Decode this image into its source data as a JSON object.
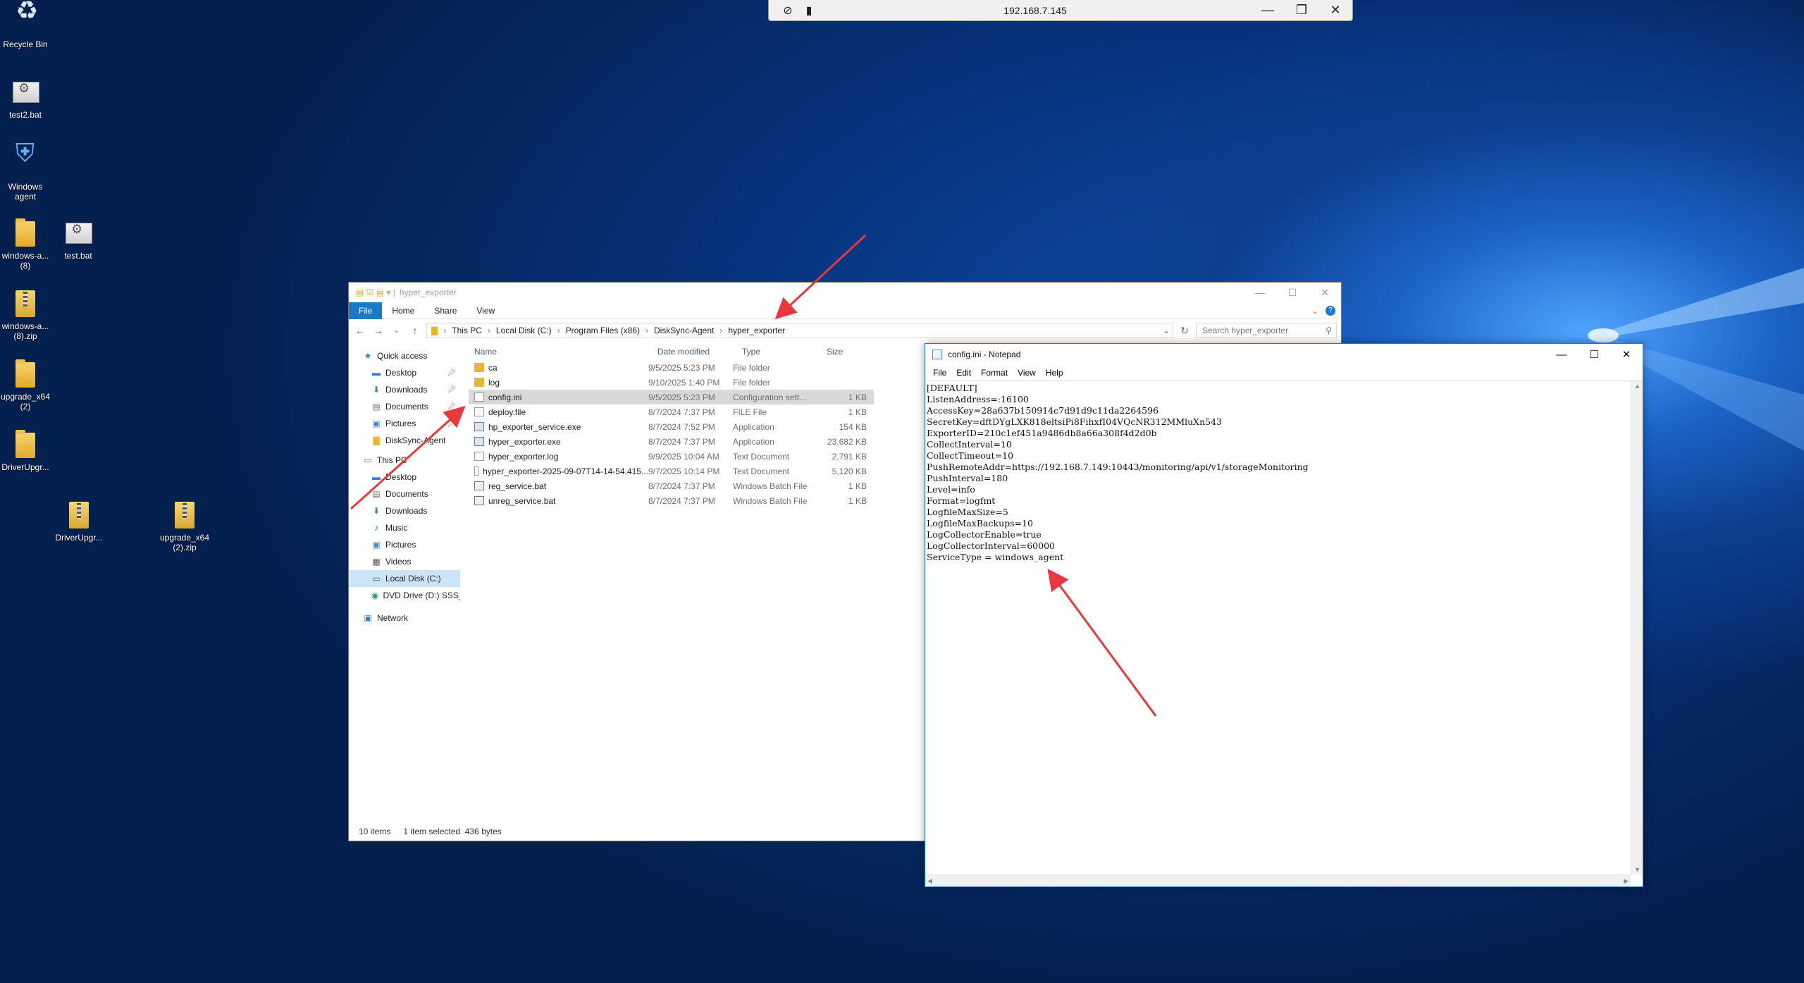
{
  "desktop": {
    "icons": [
      {
        "label": "Recycle Bin",
        "icon": "recycle-bin-icon"
      },
      {
        "label": "test2.bat",
        "icon": "batch-file-icon"
      },
      {
        "label": "Windows agent",
        "icon": "agent-shield-icon"
      },
      {
        "label": "windows-a... (8)",
        "icon": "folder-icon"
      },
      {
        "label": "test.bat",
        "icon": "batch-file-icon"
      },
      {
        "label": "windows-a... (8).zip",
        "icon": "zip-folder-icon"
      },
      {
        "label": "upgrade_x64 (2)",
        "icon": "folder-icon"
      },
      {
        "label": "DriverUpgr...",
        "icon": "folder-icon"
      },
      {
        "label": "DriverUpgr...",
        "icon": "zip-folder-icon"
      },
      {
        "label": "upgrade_x64 (2).zip",
        "icon": "zip-folder-icon"
      }
    ]
  },
  "rdp_bar": {
    "host": "192.168.7.145",
    "pin_icon": "pin-off-icon",
    "signal_icon": "signal-bars-icon"
  },
  "explorer": {
    "title": "hyper_exporter",
    "ribbon_tabs": [
      "File",
      "Home",
      "Share",
      "View"
    ],
    "breadcrumb": [
      "This PC",
      "Local Disk (C:)",
      "Program Files (x86)",
      "DiskSync-Agent",
      "hyper_exporter"
    ],
    "search_placeholder": "Search hyper_exporter",
    "nav": {
      "quick_access": "Quick access",
      "quick_items": [
        "Desktop",
        "Downloads",
        "Documents",
        "Pictures",
        "DiskSync-Agent"
      ],
      "this_pc": "This PC",
      "pc_items": [
        "Desktop",
        "Documents",
        "Downloads",
        "Music",
        "Pictures",
        "Videos",
        "Local Disk (C:)",
        "DVD Drive (D:) SSS_"
      ],
      "network": "Network"
    },
    "columns": {
      "name": "Name",
      "date": "Date modified",
      "type": "Type",
      "size": "Size"
    },
    "files": [
      {
        "name": "ca",
        "date": "9/5/2025 5:23 PM",
        "type": "File folder",
        "size": "",
        "kind": "folder"
      },
      {
        "name": "log",
        "date": "9/10/2025 1:40 PM",
        "type": "File folder",
        "size": "",
        "kind": "folder"
      },
      {
        "name": "config.ini",
        "date": "9/5/2025 5:23 PM",
        "type": "Configuration sett...",
        "size": "1 KB",
        "kind": "doc"
      },
      {
        "name": "deploy.file",
        "date": "8/7/2024 7:37 PM",
        "type": "FILE File",
        "size": "1 KB",
        "kind": "doc"
      },
      {
        "name": "hp_exporter_service.exe",
        "date": "8/7/2024 7:52 PM",
        "type": "Application",
        "size": "154 KB",
        "kind": "exe"
      },
      {
        "name": "hyper_exporter.exe",
        "date": "8/7/2024 7:37 PM",
        "type": "Application",
        "size": "23,682 KB",
        "kind": "exe"
      },
      {
        "name": "hyper_exporter.log",
        "date": "9/9/2025 10:04 AM",
        "type": "Text Document",
        "size": "2,791 KB",
        "kind": "doc"
      },
      {
        "name": "hyper_exporter-2025-09-07T14-14-54.415...",
        "date": "9/7/2025 10:14 PM",
        "type": "Text Document",
        "size": "5,120 KB",
        "kind": "doc"
      },
      {
        "name": "reg_service.bat",
        "date": "8/7/2024 7:37 PM",
        "type": "Windows Batch File",
        "size": "1 KB",
        "kind": "bat"
      },
      {
        "name": "unreg_service.bat",
        "date": "8/7/2024 7:37 PM",
        "type": "Windows Batch File",
        "size": "1 KB",
        "kind": "bat"
      }
    ],
    "selected_index": 2,
    "status": {
      "count": "10 items",
      "selection": "1 item selected",
      "bytes": "436 bytes"
    }
  },
  "notepad": {
    "title": "config.ini - Notepad",
    "menu": [
      "File",
      "Edit",
      "Format",
      "View",
      "Help"
    ],
    "content": "[DEFAULT]\nListenAddress=:16100\nAccessKey=28a637b150914c7d91d9c11da2264596\nSecretKey=dftDYgLXK818eltsiPi8FihxfI04VQcNR312MMluXn543\nExporterID=210c1ef451a9486db8a66a308f4d2d0b\nCollectInterval=10\nCollectTimeout=10\nPushRemoteAddr=https://192.168.7.149:10443/monitoring/api/v1/storageMonitoring\nPushInterval=180\nLevel=info\nFormat=logfmt\nLogfileMaxSize=5\nLogfileMaxBackups=10\nLogCollectorEnable=true\nLogCollectorInterval=60000\nServiceType = windows_agent"
  },
  "colors": {
    "accent": "#1979ca",
    "annotation": "#e8383d",
    "selection": "#d9d9d9"
  }
}
